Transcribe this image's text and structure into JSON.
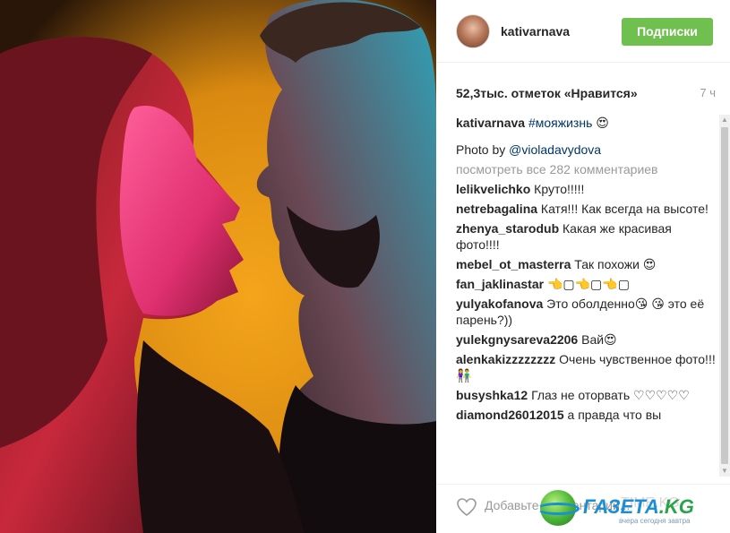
{
  "post": {
    "username": "kativarnava",
    "follow_label": "Подписки",
    "likes": "52,3тыс. отметок «Нравится»",
    "time": "7 ч"
  },
  "caption": {
    "user": "kativarnava",
    "hashtag": "#мояжизнь",
    "emoji": "😍",
    "photo_by_prefix": "Photo by",
    "photo_by_handle": "@violadavydova"
  },
  "view_all": "посмотреть все 282 комментариев",
  "comments": [
    {
      "user": "lelikvelichko",
      "text": "Круто!!!!!"
    },
    {
      "user": "netrebagalina",
      "text": "Катя!!! Как всегда на высоте!"
    },
    {
      "user": "zhenya_starodub",
      "text": "Какая же красивая фото!!!!"
    },
    {
      "user": "mebel_ot_masterra",
      "text": "Так похожи 😍"
    },
    {
      "user": "fan_jaklinastar",
      "text": "👈▢👈▢👈▢"
    },
    {
      "user": "yulyakofanova",
      "text": "Это оболденно😘 😘 это её парень?))"
    },
    {
      "user": "yulekgnysareva2206",
      "text": "Вай😍"
    },
    {
      "user": "alenkakizzzzzzzz",
      "text": "Очень чувственное фото!!!👫"
    },
    {
      "user": "busyshka12",
      "text": "Глаз не оторвать ♡♡♡♡♡"
    },
    {
      "user": "diamond26012015",
      "text": "а правда что вы"
    }
  ],
  "footer": {
    "comment_placeholder": "Добавьте комментарий...",
    "watermark_text": "ГАЗЕТА",
    "watermark_tld": ".KG",
    "watermark_sub": "вчера сегодня завтра",
    "watermark_faded": "TIME.KG"
  },
  "icons": {
    "heart": "heart-outline-icon",
    "scroll_up": "arrow-up-icon",
    "scroll_down": "arrow-down-icon"
  },
  "colors": {
    "follow_button": "#70c050",
    "link": "#003569",
    "muted": "#999999"
  }
}
